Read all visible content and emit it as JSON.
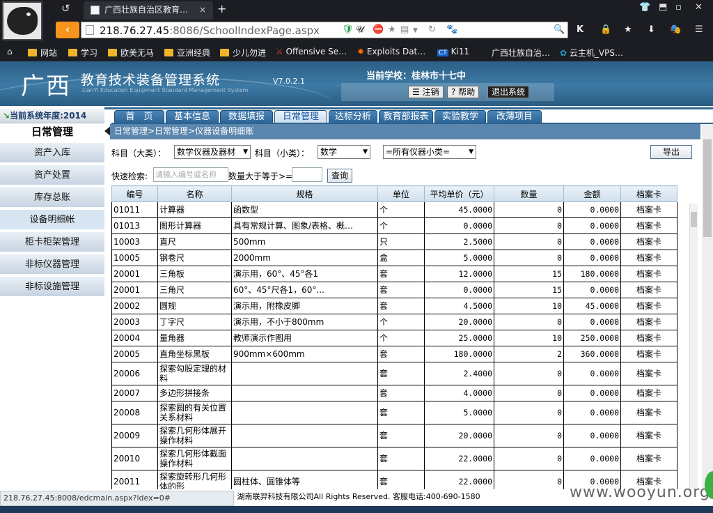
{
  "browser": {
    "tab_title": "广西壮族自治区教育…",
    "tab_close": "×",
    "new_tab": "+",
    "back_tab_icon": "↺",
    "url_host": "218.76.27.45",
    "url_path": ":8086/SchoolIndexPage.aspx",
    "bookmarks": [
      "网站",
      "学习",
      "欧美无马",
      "亚洲经典",
      "少儿勿进",
      "Offensive Se…",
      "Exploits Dat…",
      "Ki11",
      "广西壮族自治…",
      "云主机_VPS…"
    ],
    "status_url": "218.76.27.45:8008/edcmain.aspx?idex=0#",
    "watermark": "www.wooyun.org"
  },
  "header": {
    "logo": "广西",
    "system_title": "教育技术装备管理系统",
    "system_subtitle": "LianYi Education Equipment Standard Management System",
    "version": "V7.0.2.1",
    "current_school": "当前学校：桂林市十七中",
    "logout": "注销",
    "help": "帮助",
    "exit": "退出系统"
  },
  "sidebar": {
    "year": "当前系统年度:2014",
    "title": "日常管理",
    "items": [
      "资产入库",
      "资产处置",
      "库存总账",
      "设备明细帐",
      "柜卡柜架管理",
      "非标仪器管理",
      "非标设施管理"
    ],
    "active_index": 3
  },
  "menu": {
    "tabs": [
      "首　页",
      "基本信息",
      "数据填报",
      "日常管理",
      "达标分析",
      "教育部报表",
      "实验教学",
      "改薄项目"
    ],
    "active_index": 3
  },
  "breadcrumb": "日常管理>日常管理>仪器设备明细账",
  "filters": {
    "category_major_label": "科目（大类）：",
    "category_major_value": "数学仪器及器材",
    "category_minor_label": "科目（小类）：",
    "category_minor_value": "数学",
    "instrument_subclass_value": "=所有仪器小类=",
    "export": "导出",
    "quick_search_label": "快速检索:",
    "search_placeholder": "请输入编号或名称",
    "qty_label": "数量大于等于>=",
    "qty_value": "",
    "query": "查询"
  },
  "table": {
    "columns": [
      "编号",
      "名称",
      "规格",
      "单位",
      "平均单价（元）",
      "数量",
      "金额",
      "档案卡"
    ],
    "rows": [
      {
        "code": "01011",
        "name": "计算器",
        "spec": "函数型",
        "unit": "个",
        "price": "45.0000",
        "qty": "0",
        "amount": "0.0000",
        "card": "档案卡"
      },
      {
        "code": "01013",
        "name": "图形计算器",
        "spec": "具有常规计算、图象/表格、概…",
        "unit": "个",
        "price": "0.0000",
        "qty": "0",
        "amount": "0.0000",
        "card": "档案卡"
      },
      {
        "code": "10003",
        "name": "直尺",
        "spec": "500mm",
        "unit": "只",
        "price": "2.5000",
        "qty": "0",
        "amount": "0.0000",
        "card": "档案卡"
      },
      {
        "code": "10005",
        "name": "钢卷尺",
        "spec": "2000mm",
        "unit": "盒",
        "price": "5.0000",
        "qty": "0",
        "amount": "0.0000",
        "card": "档案卡"
      },
      {
        "code": "20001",
        "name": "三角板",
        "spec": "演示用，60°、45°各1",
        "unit": "套",
        "price": "12.0000",
        "qty": "15",
        "amount": "180.0000",
        "card": "档案卡"
      },
      {
        "code": "20001",
        "name": "三角尺",
        "spec": "60°、45°尺各1，60°...",
        "unit": "套",
        "price": "0.0000",
        "qty": "15",
        "amount": "0.0000",
        "card": "档案卡"
      },
      {
        "code": "20002",
        "name": "圆规",
        "spec": "演示用，附橡皮脚",
        "unit": "套",
        "price": "4.5000",
        "qty": "10",
        "amount": "45.0000",
        "card": "档案卡"
      },
      {
        "code": "20003",
        "name": "丁字尺",
        "spec": "演示用，不小于800mm",
        "unit": "个",
        "price": "20.0000",
        "qty": "0",
        "amount": "0.0000",
        "card": "档案卡"
      },
      {
        "code": "20004",
        "name": "量角器",
        "spec": "教师演示作图用",
        "unit": "个",
        "price": "25.0000",
        "qty": "10",
        "amount": "250.0000",
        "card": "档案卡"
      },
      {
        "code": "20005",
        "name": "直角坐标黑板",
        "spec": "900mm×600mm",
        "unit": "套",
        "price": "180.0000",
        "qty": "2",
        "amount": "360.0000",
        "card": "档案卡"
      },
      {
        "code": "20006",
        "name": "探索勾股定理的材料",
        "spec": "",
        "unit": "套",
        "price": "2.4000",
        "qty": "0",
        "amount": "0.0000",
        "card": "档案卡"
      },
      {
        "code": "20007",
        "name": "多边形拼接条",
        "spec": "",
        "unit": "套",
        "price": "4.0000",
        "qty": "0",
        "amount": "0.0000",
        "card": "档案卡"
      },
      {
        "code": "20008",
        "name": "探索圆的有关位置关系材料",
        "spec": "",
        "unit": "套",
        "price": "5.0000",
        "qty": "0",
        "amount": "0.0000",
        "card": "档案卡"
      },
      {
        "code": "20009",
        "name": "探索几何形体展开操作材料",
        "spec": "",
        "unit": "套",
        "price": "20.0000",
        "qty": "0",
        "amount": "0.0000",
        "card": "档案卡"
      },
      {
        "code": "20010",
        "name": "探索几何形体截面操作材料",
        "spec": "",
        "unit": "套",
        "price": "22.0000",
        "qty": "0",
        "amount": "0.0000",
        "card": "档案卡"
      },
      {
        "code": "20011",
        "name": "探索旋转形几何形体的形",
        "spec": "圆柱体、圆锥体等",
        "unit": "套",
        "price": "22.0000",
        "qty": "0",
        "amount": "0.0000",
        "card": "档案卡"
      }
    ]
  },
  "footer": "9 湖南联羿科技有限公司All Rights Reserved. 客服电话:400-690-1580"
}
